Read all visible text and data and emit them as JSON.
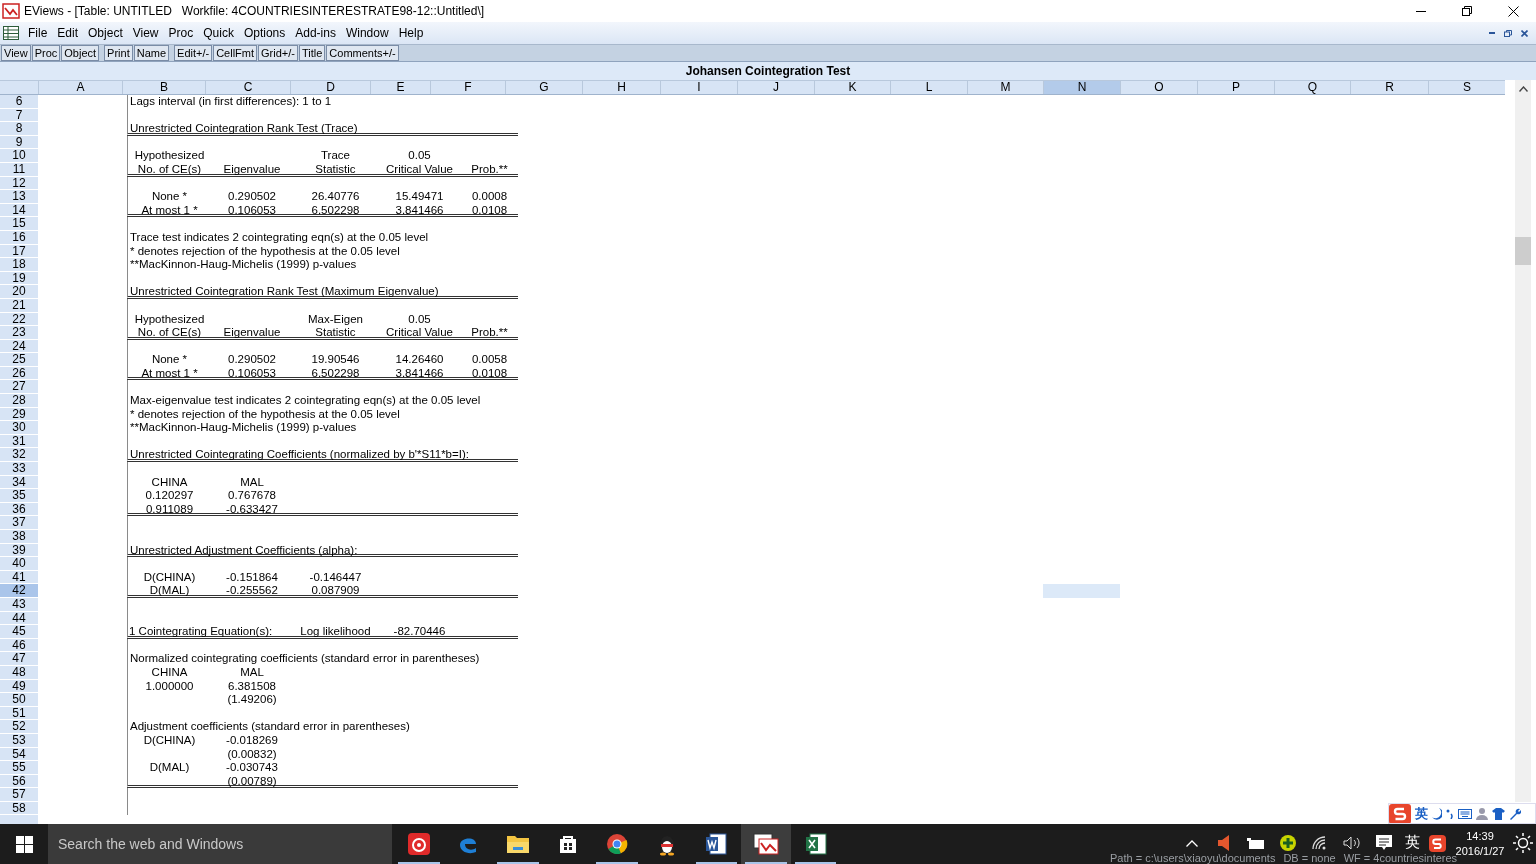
{
  "window": {
    "title": "EViews - [Table: UNTITLED   Workfile: 4COUNTRIESINTERESTRATE98-12::Untitled\\]"
  },
  "menu": [
    "File",
    "Edit",
    "Object",
    "View",
    "Proc",
    "Quick",
    "Options",
    "Add-ins",
    "Window",
    "Help"
  ],
  "toolbar": [
    [
      "View",
      "Proc",
      "Object"
    ],
    [
      "Print",
      "Name"
    ],
    [
      "Edit+/-",
      "CellFmt",
      "Grid+/-",
      "Title",
      "Comments+/-"
    ]
  ],
  "sheet": {
    "title": "Johansen Cointegration Test",
    "columns": [
      {
        "label": "A",
        "selected": false
      },
      {
        "label": "B",
        "selected": false
      },
      {
        "label": "C",
        "selected": false
      },
      {
        "label": "D",
        "selected": false
      },
      {
        "label": "E",
        "selected": false
      },
      {
        "label": "F",
        "selected": false
      },
      {
        "label": "G",
        "selected": false
      },
      {
        "label": "H",
        "selected": false
      },
      {
        "label": "I",
        "selected": false
      },
      {
        "label": "J",
        "selected": false
      },
      {
        "label": "K",
        "selected": false
      },
      {
        "label": "L",
        "selected": false
      },
      {
        "label": "M",
        "selected": false
      },
      {
        "label": "N",
        "selected": true
      },
      {
        "label": "O",
        "selected": false
      },
      {
        "label": "P",
        "selected": false
      },
      {
        "label": "Q",
        "selected": false
      },
      {
        "label": "R",
        "selected": false
      },
      {
        "label": "S",
        "selected": false
      }
    ],
    "rows": [
      {
        "row": "6",
        "selected": false,
        "kind": "text",
        "text": "Lags interval (in first differences): 1 to 1",
        "rule_below": false
      },
      {
        "row": "7",
        "selected": false,
        "kind": "blank",
        "rule_below": false
      },
      {
        "row": "8",
        "selected": false,
        "kind": "text",
        "text": "Unrestricted Cointegration Rank Test (Trace)",
        "rule_below": true
      },
      {
        "row": "9",
        "selected": false,
        "kind": "blank",
        "rule_below": false
      },
      {
        "row": "10",
        "selected": false,
        "kind": "header",
        "cells": [
          "Hypothesized",
          "Trace",
          "0.05"
        ],
        "rule_below": false
      },
      {
        "row": "11",
        "selected": false,
        "kind": "cells",
        "cells": [
          "No. of CE(s)",
          "Eigenvalue",
          "Statistic",
          "Critical Value",
          "Prob.**"
        ],
        "rule_below": true
      },
      {
        "row": "12",
        "selected": false,
        "kind": "blank",
        "rule_below": false
      },
      {
        "row": "13",
        "selected": false,
        "kind": "cells",
        "cells": [
          "None *",
          "0.290502",
          "26.40776",
          "15.49471",
          "0.0008"
        ],
        "rule_below": false
      },
      {
        "row": "14",
        "selected": false,
        "kind": "cells",
        "cells": [
          "At most 1 *",
          "0.106053",
          "6.502298",
          "3.841466",
          "0.0108"
        ],
        "rule_below": true
      },
      {
        "row": "15",
        "selected": false,
        "kind": "blank",
        "rule_below": false
      },
      {
        "row": "16",
        "selected": false,
        "kind": "text",
        "text": "Trace test indicates 2 cointegrating eqn(s) at the 0.05 level",
        "rule_below": false
      },
      {
        "row": "17",
        "selected": false,
        "kind": "text",
        "text": "* denotes rejection of the hypothesis at the 0.05 level",
        "rule_below": false
      },
      {
        "row": "18",
        "selected": false,
        "kind": "text",
        "text": "**MacKinnon-Haug-Michelis (1999) p-values",
        "rule_below": false
      },
      {
        "row": "19",
        "selected": false,
        "kind": "blank",
        "rule_below": false
      },
      {
        "row": "20",
        "selected": false,
        "kind": "text",
        "text": "Unrestricted Cointegration Rank Test (Maximum Eigenvalue)",
        "rule_below": true
      },
      {
        "row": "21",
        "selected": false,
        "kind": "blank",
        "rule_below": false
      },
      {
        "row": "22",
        "selected": false,
        "kind": "header",
        "cells": [
          "Hypothesized",
          "Max-Eigen",
          "0.05"
        ],
        "rule_below": false
      },
      {
        "row": "23",
        "selected": false,
        "kind": "cells",
        "cells": [
          "No. of CE(s)",
          "Eigenvalue",
          "Statistic",
          "Critical Value",
          "Prob.**"
        ],
        "rule_below": true
      },
      {
        "row": "24",
        "selected": false,
        "kind": "blank",
        "rule_below": false
      },
      {
        "row": "25",
        "selected": false,
        "kind": "cells",
        "cells": [
          "None *",
          "0.290502",
          "19.90546",
          "14.26460",
          "0.0058"
        ],
        "rule_below": false
      },
      {
        "row": "26",
        "selected": false,
        "kind": "cells",
        "cells": [
          "At most 1 *",
          "0.106053",
          "6.502298",
          "3.841466",
          "0.0108"
        ],
        "rule_below": true
      },
      {
        "row": "27",
        "selected": false,
        "kind": "blank",
        "rule_below": false
      },
      {
        "row": "28",
        "selected": false,
        "kind": "text",
        "text": "Max-eigenvalue test indicates 2 cointegrating eqn(s) at the 0.05 level",
        "rule_below": false
      },
      {
        "row": "29",
        "selected": false,
        "kind": "text",
        "text": "* denotes rejection of the hypothesis at the 0.05 level",
        "rule_below": false
      },
      {
        "row": "30",
        "selected": false,
        "kind": "text",
        "text": "**MacKinnon-Haug-Michelis (1999) p-values",
        "rule_below": false
      },
      {
        "row": "31",
        "selected": false,
        "kind": "blank",
        "rule_below": false
      },
      {
        "row": "32",
        "selected": false,
        "kind": "text",
        "text": "Unrestricted Cointegrating Coefficients (normalized by b'*S11*b=I):",
        "rule_below": true
      },
      {
        "row": "33",
        "selected": false,
        "kind": "blank",
        "rule_below": false
      },
      {
        "row": "34",
        "selected": false,
        "kind": "cells",
        "cells": [
          "CHINA",
          "MAL"
        ],
        "rule_below": false
      },
      {
        "row": "35",
        "selected": false,
        "kind": "cells",
        "cells": [
          "0.120297",
          "0.767678"
        ],
        "rule_below": false
      },
      {
        "row": "36",
        "selected": false,
        "kind": "cells",
        "cells": [
          "0.911089",
          "-0.633427"
        ],
        "rule_below": true
      },
      {
        "row": "37",
        "selected": false,
        "kind": "blank",
        "rule_below": false
      },
      {
        "row": "38",
        "selected": false,
        "kind": "blank",
        "rule_below": false
      },
      {
        "row": "39",
        "selected": false,
        "kind": "text",
        "text": "Unrestricted Adjustment Coefficients (alpha):",
        "rule_below": true
      },
      {
        "row": "40",
        "selected": false,
        "kind": "blank",
        "rule_below": false
      },
      {
        "row": "41",
        "selected": false,
        "kind": "cells",
        "cells": [
          "D(CHINA)",
          "-0.151864",
          "-0.146447"
        ],
        "rule_below": false
      },
      {
        "row": "42",
        "selected": true,
        "kind": "cells",
        "cells": [
          "D(MAL)",
          "-0.255562",
          "0.087909"
        ],
        "rule_below": true
      },
      {
        "row": "43",
        "selected": false,
        "kind": "blank",
        "rule_below": false
      },
      {
        "row": "44",
        "selected": false,
        "kind": "blank",
        "rule_below": false
      },
      {
        "row": "45",
        "selected": false,
        "kind": "equation",
        "text": "1 Cointegrating Equation(s):",
        "cells": [
          "Log likelihood",
          "-82.70446"
        ],
        "rule_below": true
      },
      {
        "row": "46",
        "selected": false,
        "kind": "blank",
        "rule_below": false
      },
      {
        "row": "47",
        "selected": false,
        "kind": "text",
        "text": "Normalized cointegrating coefficients (standard error in parentheses)",
        "rule_below": false
      },
      {
        "row": "48",
        "selected": false,
        "kind": "cells",
        "cells": [
          "CHINA",
          "MAL"
        ],
        "rule_below": false
      },
      {
        "row": "49",
        "selected": false,
        "kind": "cells",
        "cells": [
          "1.000000",
          "6.381508"
        ],
        "rule_below": false
      },
      {
        "row": "50",
        "selected": false,
        "kind": "se",
        "cells": [
          "(1.49206)"
        ],
        "rule_below": false
      },
      {
        "row": "51",
        "selected": false,
        "kind": "blank",
        "rule_below": false
      },
      {
        "row": "52",
        "selected": false,
        "kind": "text",
        "text": "Adjustment coefficients (standard error in parentheses)",
        "rule_below": false
      },
      {
        "row": "53",
        "selected": false,
        "kind": "cells",
        "cells": [
          "D(CHINA)",
          "-0.018269"
        ],
        "rule_below": false
      },
      {
        "row": "54",
        "selected": false,
        "kind": "se",
        "cells": [
          "(0.00832)"
        ],
        "rule_below": false
      },
      {
        "row": "55",
        "selected": false,
        "kind": "cells",
        "cells": [
          "D(MAL)",
          "-0.030743"
        ],
        "rule_below": false
      },
      {
        "row": "56",
        "selected": false,
        "kind": "se",
        "cells": [
          "(0.00789)"
        ],
        "rule_below": true
      },
      {
        "row": "57",
        "selected": false,
        "kind": "blank",
        "rule_below": false
      },
      {
        "row": "58",
        "selected": false,
        "kind": "blank",
        "rule_below": false
      }
    ]
  },
  "ime_bar": {
    "mode": "英"
  },
  "status_bar": [
    "Path = c:\\users\\xiaoyu\\documents",
    "DB = none",
    "WF = 4countriesinteres"
  ],
  "taskbar": {
    "search": {
      "placeholder": "Search the web and Windows"
    },
    "apps": [
      {
        "kind": "music",
        "running": true,
        "selected": false
      },
      {
        "kind": "edge",
        "running": false,
        "selected": false
      },
      {
        "kind": "folder",
        "running": true,
        "selected": false
      },
      {
        "kind": "store",
        "running": false,
        "selected": false
      },
      {
        "kind": "chrome",
        "running": true,
        "selected": false
      },
      {
        "kind": "penguin",
        "running": false,
        "selected": false
      },
      {
        "kind": "word",
        "running": true,
        "selected": false
      },
      {
        "kind": "eviews",
        "running": true,
        "selected": true
      },
      {
        "kind": "excel",
        "running": true,
        "selected": false
      }
    ],
    "input_mode": "英",
    "time": "14:39",
    "date": "2016/1/27"
  }
}
